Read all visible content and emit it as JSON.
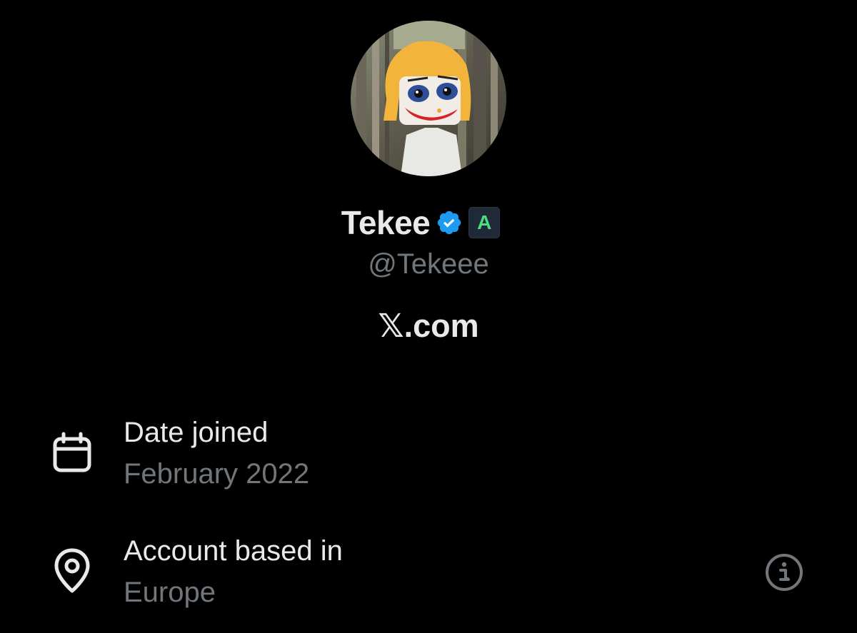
{
  "profile": {
    "display_name": "Tekee",
    "handle": "@Tekeee",
    "site": "𝕏.com",
    "affiliate_badge_letter": "A",
    "verified_color": "#1d9bf0",
    "affiliate_badge_color": "#4ade80"
  },
  "details": {
    "date_joined": {
      "icon": "calendar-icon",
      "label": "Date joined",
      "value": "February 2022"
    },
    "location": {
      "icon": "location-pin-icon",
      "label": "Account based in",
      "value": "Europe",
      "info_icon": "info-icon"
    }
  },
  "colors": {
    "background": "#000000",
    "primary_text": "#e7e9ea",
    "secondary_text": "#71767b"
  }
}
